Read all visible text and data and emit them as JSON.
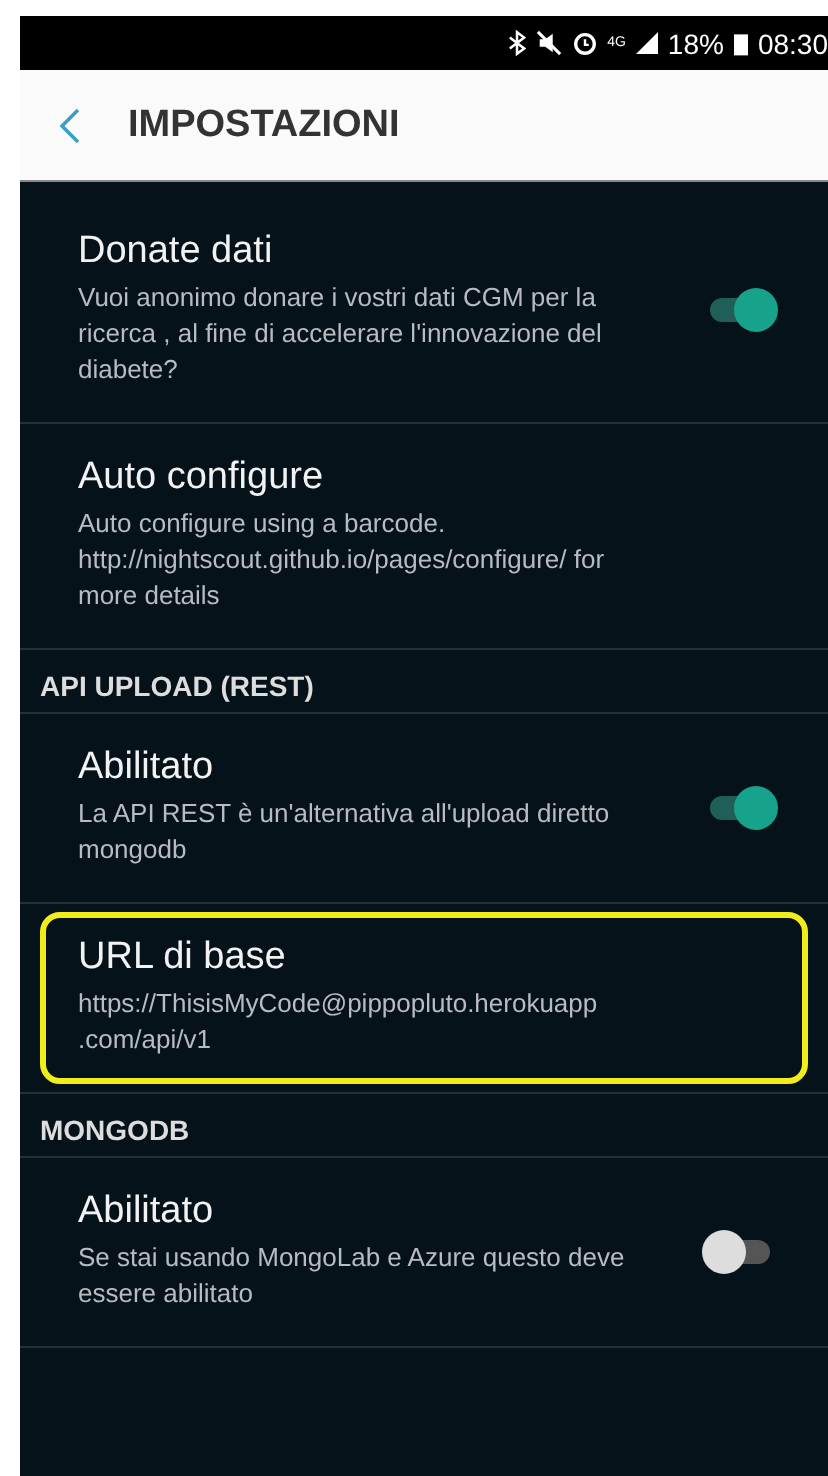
{
  "status_bar": {
    "network": "4G",
    "battery": "18%",
    "time": "08:30"
  },
  "header": {
    "title": "IMPOSTAZIONI"
  },
  "sections": [
    {
      "items": [
        {
          "kind": "switch",
          "title": "Donate dati",
          "summary": "Vuoi anonimo donare i vostri dati CGM per la ricerca , al fine di accelerare l'innovazione del diabete?",
          "on": true,
          "highlighted": false
        },
        {
          "kind": "text",
          "title": "Auto configure",
          "summary": "Auto configure using a barcode. http://nightscout.github.io/pages/configure/ for more details",
          "highlighted": false
        }
      ]
    },
    {
      "header": "API UPLOAD (REST)",
      "items": [
        {
          "kind": "switch",
          "title": "Abilitato",
          "summary": "La API REST è un'alternativa all'upload diretto mongodb",
          "on": true,
          "highlighted": false
        },
        {
          "kind": "text",
          "title": "URL di base",
          "summary": "https://ThisisMyCode@pippopluto.herokuapp .com/api/v1",
          "highlighted": true
        }
      ]
    },
    {
      "header": "MONGODB",
      "items": [
        {
          "kind": "switch",
          "title": "Abilitato",
          "summary": "Se stai usando MongoLab e Azure questo deve essere abilitato",
          "on": false,
          "highlighted": false
        }
      ]
    }
  ]
}
